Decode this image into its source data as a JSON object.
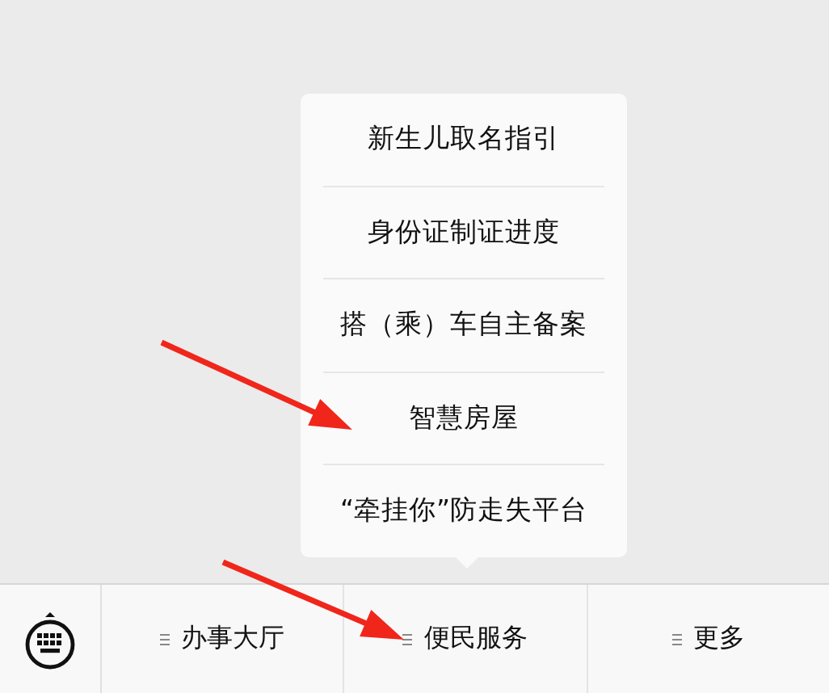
{
  "popup_menu": {
    "items": [
      "新生儿取名指引",
      "身份证制证进度",
      "搭（乘）车自主备案",
      "智慧房屋",
      "“牵挂你”防走失平台"
    ]
  },
  "bottom_menu": {
    "items": [
      {
        "label": "办事大厅"
      },
      {
        "label": "便民服务"
      },
      {
        "label": "更多"
      }
    ]
  },
  "annotations": [
    {
      "kind": "arrow"
    },
    {
      "kind": "arrow"
    }
  ]
}
